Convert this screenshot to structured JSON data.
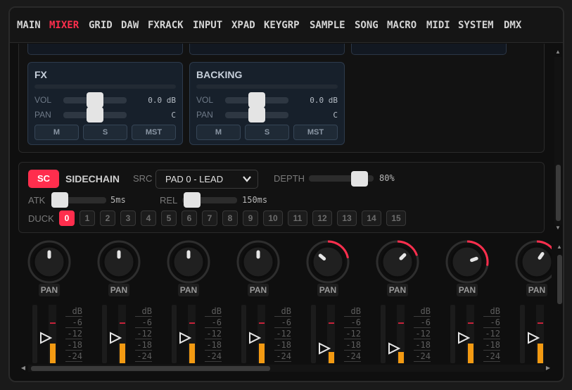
{
  "nav": {
    "items": [
      "MAIN",
      "MIXER",
      "GRID",
      "DAW",
      "FXRACK",
      "INPUT",
      "XPAD",
      "KEYGRP",
      "SAMPLE",
      "SONG",
      "MACRO",
      "MIDI",
      "SYSTEM",
      "DMX"
    ],
    "active": "MIXER"
  },
  "strips": [
    {
      "title": "FX",
      "vol_label": "VOL",
      "vol_value": "0.0 dB",
      "pan_label": "PAN",
      "pan_value": "C",
      "mute": "M",
      "solo": "S",
      "master": "MST"
    },
    {
      "title": "BACKING",
      "vol_label": "VOL",
      "vol_value": "0.0 dB",
      "pan_label": "PAN",
      "pan_value": "C",
      "mute": "M",
      "solo": "S",
      "master": "MST"
    }
  ],
  "sidechain": {
    "toggle_label": "SC",
    "title": "SIDECHAIN",
    "src_label": "SRC",
    "src_value": "PAD 0 - LEAD",
    "depth_label": "DEPTH",
    "depth_value": "80%",
    "depth_level": 0.8,
    "atk_label": "ATK",
    "atk_value": "5ms",
    "rel_label": "REL",
    "rel_value": "150ms",
    "duck_label": "DUCK",
    "duck_pads": [
      "0",
      "1",
      "2",
      "3",
      "4",
      "5",
      "6",
      "7",
      "8",
      "9",
      "10",
      "11",
      "12",
      "13",
      "14",
      "15"
    ],
    "duck_active": "0"
  },
  "mixer": {
    "pan_label": "PAN",
    "db_scale": [
      "dB",
      "-6",
      "-12",
      "-18",
      "-24"
    ],
    "channel_count": 8
  },
  "colors": {
    "accent": "#ff2e4d",
    "meter": "#f39a12",
    "strip_bg": "#17202b"
  }
}
